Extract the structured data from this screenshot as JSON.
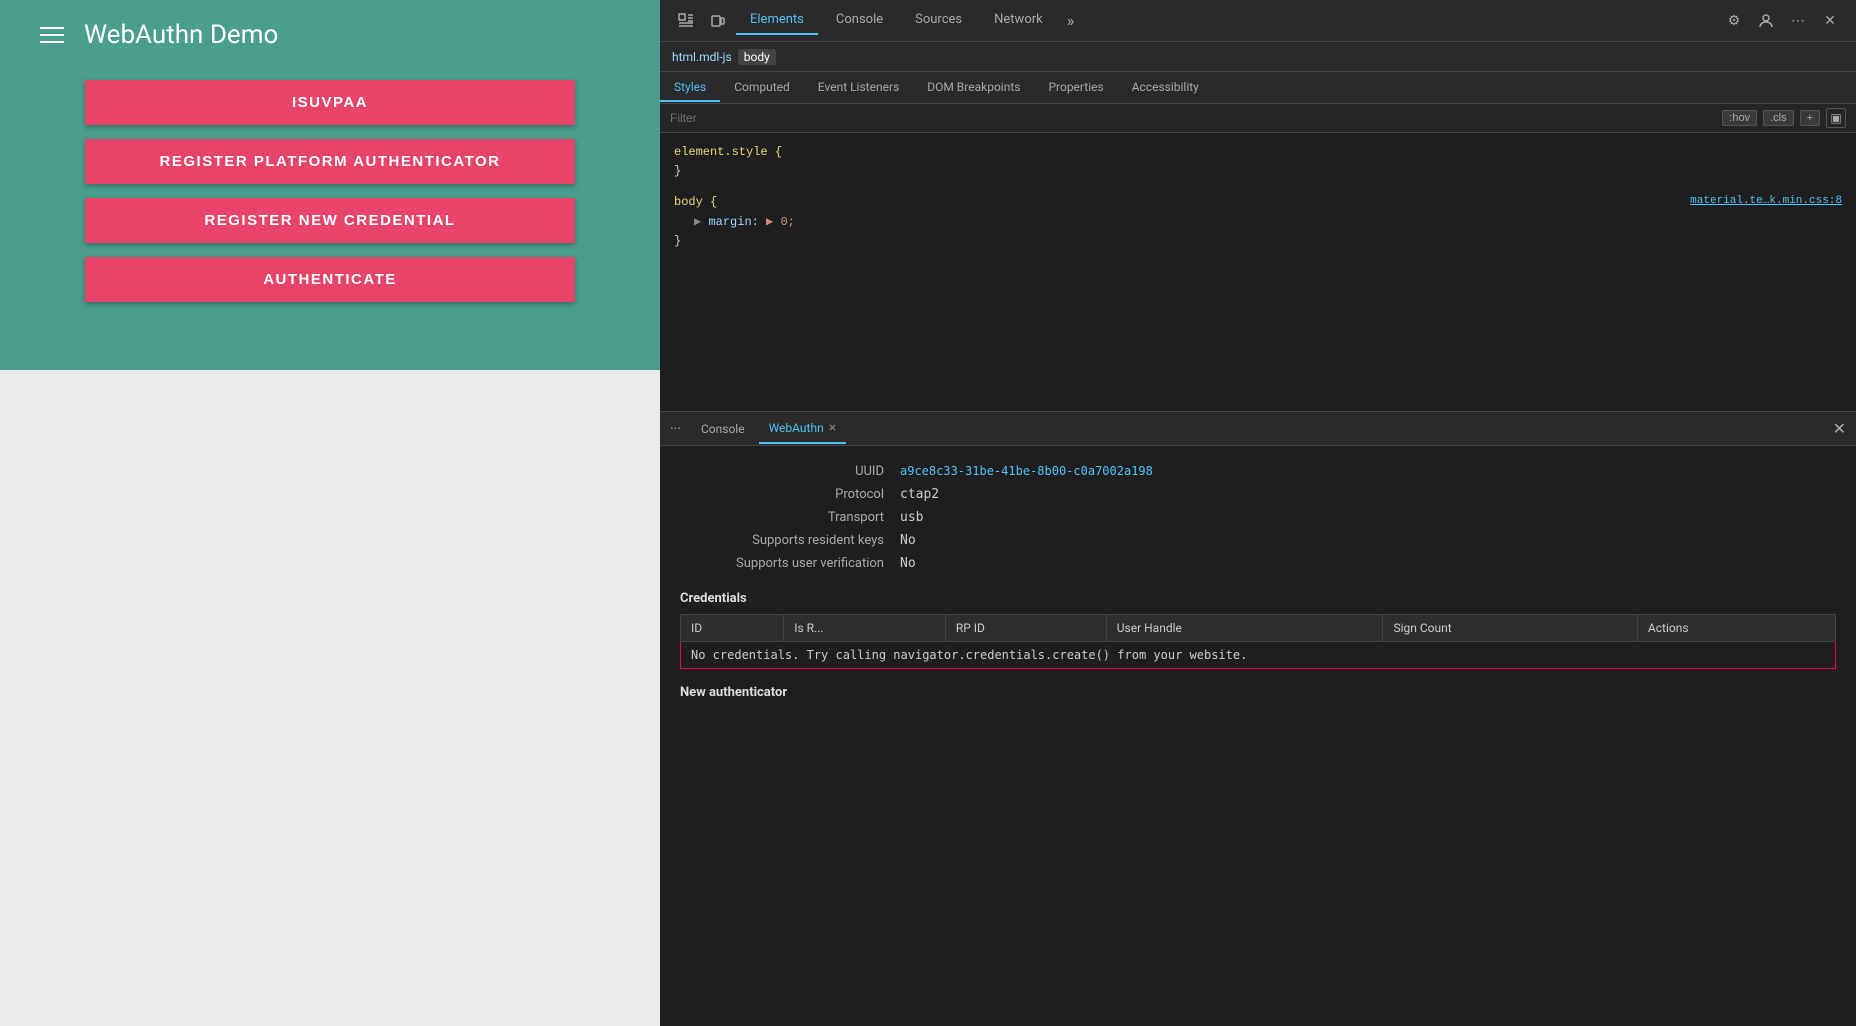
{
  "app": {
    "title": "WebAuthn Demo",
    "buttons": [
      {
        "label": "ISUVPAA"
      },
      {
        "label": "REGISTER PLATFORM AUTHENTICATOR"
      },
      {
        "label": "REGISTER NEW CREDENTIAL"
      },
      {
        "label": "AUTHENTICATE"
      }
    ]
  },
  "devtools": {
    "topbar": {
      "tabs": [
        "Elements",
        "Console",
        "Sources",
        "Network"
      ],
      "more_label": "»",
      "active_tab": "Elements"
    },
    "breadcrumb": {
      "items": [
        "html.mdl-js",
        "body"
      ]
    },
    "styles": {
      "tabs": [
        "Styles",
        "Computed",
        "Event Listeners",
        "DOM Breakpoints",
        "Properties",
        "Accessibility"
      ],
      "filter_placeholder": "Filter",
      "filter_actions": [
        ":hov",
        ".cls",
        "+"
      ],
      "rules": [
        {
          "selector": "element.style {",
          "close": "}",
          "properties": []
        },
        {
          "selector": "body {",
          "close": "}",
          "properties": [
            {
              "name": "margin:",
              "value": "▶ 0;"
            }
          ],
          "link": "material.te…k.min.css:8"
        }
      ]
    },
    "bottom": {
      "tabs": [
        "...",
        "Console",
        "WebAuthn"
      ],
      "active_tab": "WebAuthn"
    },
    "webauthn": {
      "uuid_label": "UUID",
      "uuid_value": "a9ce8c33-31be-41be-8b00-c0a7002a198",
      "protocol_label": "Protocol",
      "protocol_value": "ctap2",
      "transport_label": "Transport",
      "transport_value": "usb",
      "resident_keys_label": "Supports resident keys",
      "resident_keys_value": "No",
      "user_verification_label": "Supports user verification",
      "user_verification_value": "No",
      "credentials_title": "Credentials",
      "table_headers": [
        "ID",
        "Is R...",
        "RP ID",
        "User Handle",
        "Sign Count",
        "Actions"
      ],
      "no_credentials_text": "No credentials. Try calling ",
      "no_credentials_code": "navigator.credentials.create()",
      "no_credentials_suffix": " from your website.",
      "new_authenticator_title": "New authenticator"
    }
  }
}
